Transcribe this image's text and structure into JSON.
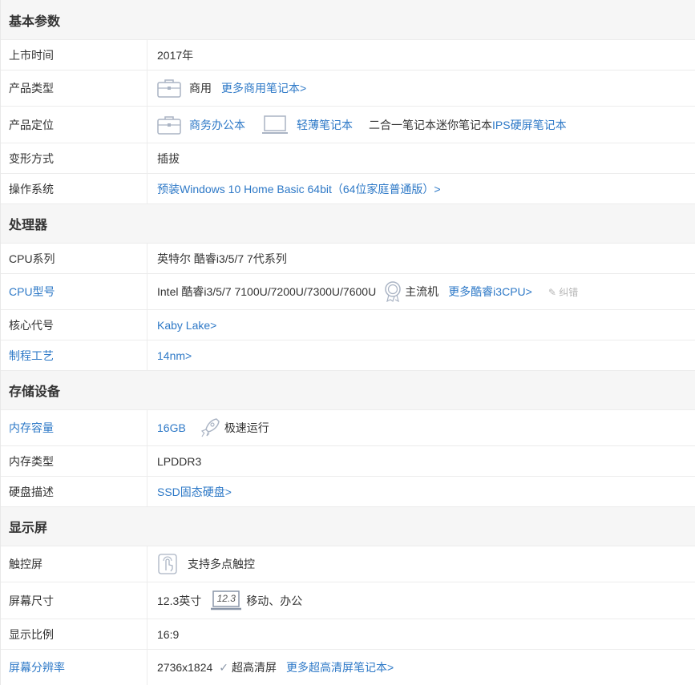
{
  "sections": {
    "basic": "基本参数",
    "processor": "处理器",
    "storage": "存储设备",
    "display": "显示屏"
  },
  "basic": {
    "launch": {
      "label": "上市时间",
      "value": "2017年"
    },
    "type": {
      "label": "产品类型",
      "value": "商用",
      "link": "更多商用笔记本>"
    },
    "position": {
      "label": "产品定位",
      "opt1": "商务办公本",
      "opt2": "轻薄笔记本",
      "plain": "二合一笔记本迷你笔记本",
      "opt3": "IPS硬屏笔记本"
    },
    "transform": {
      "label": "变形方式",
      "value": "插拔"
    },
    "os": {
      "label": "操作系统",
      "link": "预装Windows 10 Home Basic 64bit（64位家庭普通版）>"
    }
  },
  "processor": {
    "series": {
      "label": "CPU系列",
      "value": "英特尔 酷睿i3/5/7 7代系列"
    },
    "model": {
      "label": "CPU型号",
      "value": "Intel 酷睿i3/5/7 7100U/7200U/7300U/7600U",
      "badge": "主流机",
      "link": "更多酷睿i3CPU>",
      "report": "纠错"
    },
    "codename": {
      "label": "核心代号",
      "link": "Kaby Lake>"
    },
    "process": {
      "label": "制程工艺",
      "link": "14nm>"
    }
  },
  "storage": {
    "memory": {
      "label": "内存容量",
      "link": "16GB",
      "badge": "极速运行"
    },
    "memtype": {
      "label": "内存类型",
      "value": "LPDDR3"
    },
    "disk": {
      "label": "硬盘描述",
      "link": "SSD固态硬盘>"
    }
  },
  "display": {
    "touch": {
      "label": "触控屏",
      "value": "支持多点触控"
    },
    "size": {
      "label": "屏幕尺寸",
      "value": "12.3英寸",
      "icon_text": "12.3",
      "badge": "移动、办公"
    },
    "ratio": {
      "label": "显示比例",
      "value": "16:9"
    },
    "resolution": {
      "label": "屏幕分辨率",
      "value": "2736x1824",
      "badge": "超高清屏",
      "link": "更多超高清屏笔记本>"
    }
  },
  "colors": {
    "link": "#2e79c7",
    "section_bg": "#f6f6f6",
    "border": "#ececec"
  }
}
